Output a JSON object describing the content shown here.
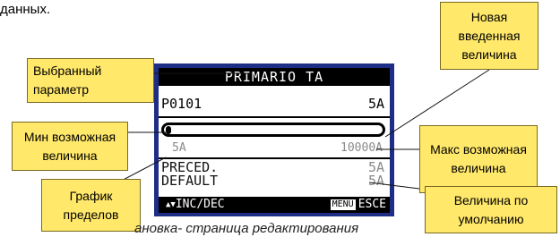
{
  "lead_text": "данных.",
  "caption": "ановка- страница редактирования",
  "screen": {
    "title": "PRIMARIO TA",
    "param_code": "P0101",
    "param_value": "5A",
    "fill_fraction": 0.0,
    "min_value": "5A",
    "max_value": "10000A",
    "prev_label": "PRECED.",
    "prev_value": "5A",
    "default_label": "DEFAULT",
    "default_value": "5A",
    "keys_label": "INC/DEC",
    "menu_tag": "MENU",
    "esc_label": "ESCE"
  },
  "callouts": {
    "selected_param": "Выбранный параметр",
    "new_value": "Новая введенная величина",
    "min_value": "Мин возможная величина",
    "max_value": "Макс возможная величина",
    "limits_graph": "График пределов",
    "default_value": "Величина по умолчанию"
  },
  "colors": {
    "callout_fill": "#ffe86a",
    "screen_frame": "#1e2d86"
  }
}
